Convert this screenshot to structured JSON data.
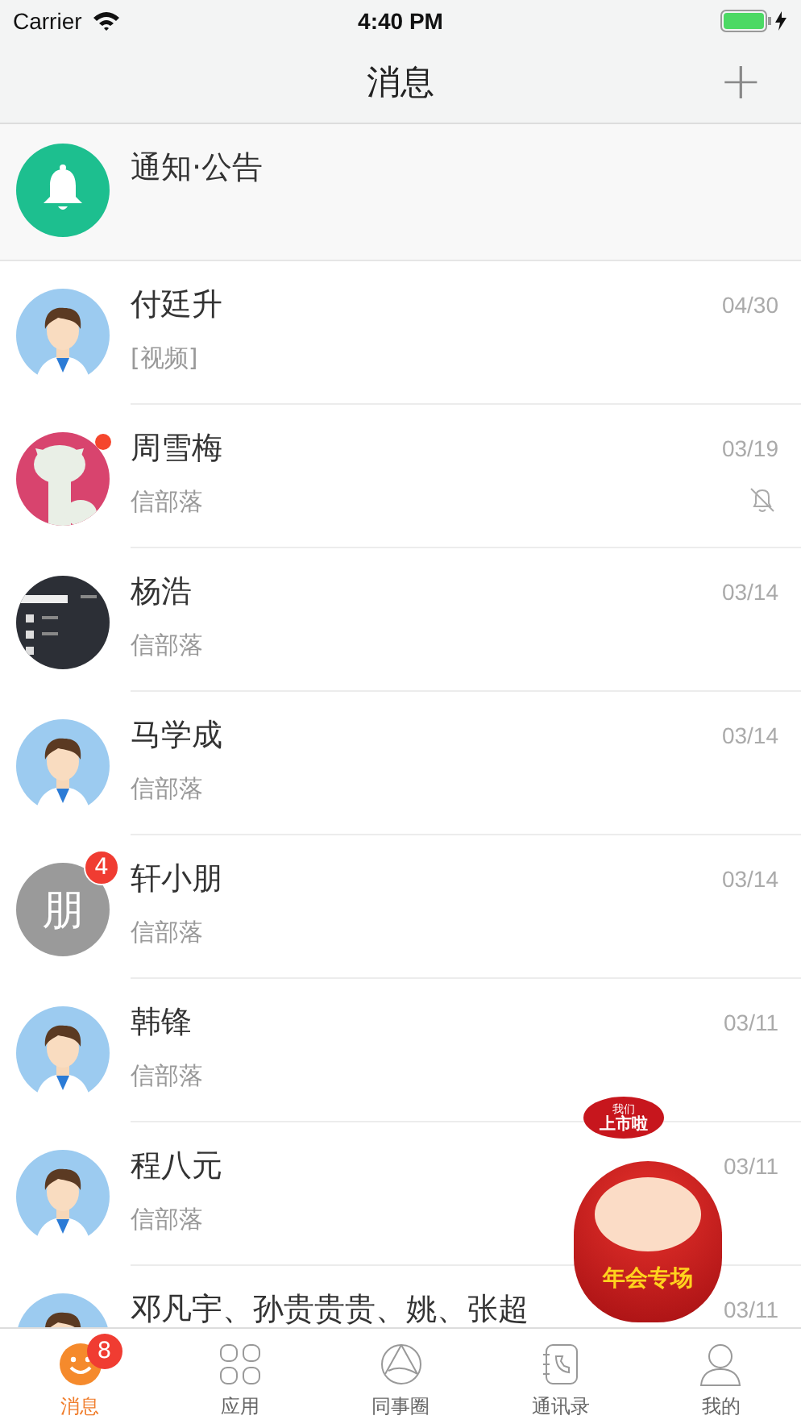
{
  "status_bar": {
    "carrier": "Carrier",
    "time": "4:40 PM",
    "battery": {
      "level": 1,
      "charging": true
    }
  },
  "nav_bar": {
    "title": "消息",
    "action": "+"
  },
  "notice": {
    "title": "通知·公告"
  },
  "conversations": [
    {
      "name": "付廷升",
      "preview": "[视频]",
      "date": "04/30",
      "avatar": {
        "kind": "person"
      },
      "unread_dot": false,
      "muted": false
    },
    {
      "name": "周雪梅",
      "preview": "信部落",
      "date": "03/19",
      "unread_dot": true,
      "muted": true
    },
    {
      "name": "杨浩",
      "preview": "信部落",
      "date": "03/14",
      "avatar": {
        "kind": "screen"
      },
      "unread_dot": false,
      "muted": false
    },
    {
      "name": "马学成",
      "preview": "信部落",
      "date": "03/14",
      "avatar": {
        "kind": "person"
      },
      "unread_dot": false,
      "muted": false
    },
    {
      "name": "轩小朋",
      "preview": "信部落",
      "date": "03/14",
      "avatar": {
        "kind": "initial",
        "text": "朋"
      },
      "badge": "4",
      "unread_dot": false,
      "muted": false
    },
    {
      "name": "韩锋",
      "preview": "信部落",
      "date": "03/11",
      "avatar": {
        "kind": "person"
      },
      "unread_dot": false,
      "muted": false
    },
    {
      "name": "程八元",
      "preview": "信部落",
      "date": "03/11",
      "avatar": {
        "kind": "person"
      },
      "unread_dot": false,
      "muted": false
    },
    {
      "name": "邓凡宇、孙贵贵贵、姚、张超",
      "date": "03/11",
      "avatar": {
        "kind": "person"
      },
      "unread_dot": false,
      "muted": false
    }
  ],
  "promo": {
    "blimp_top": "我们",
    "blimp_text": "上市啦",
    "banner": "年会专场"
  },
  "tab_bar": [
    {
      "label": "消息",
      "kind": "smile",
      "selected": true,
      "badge": "8"
    },
    {
      "label": "应用",
      "kind": "grid",
      "selected": false
    },
    {
      "label": "同事圈",
      "kind": "circle",
      "selected": false
    },
    {
      "label": "通讯录",
      "kind": "contacts",
      "selected": false
    },
    {
      "label": "我的",
      "kind": "user",
      "selected": false
    }
  ]
}
